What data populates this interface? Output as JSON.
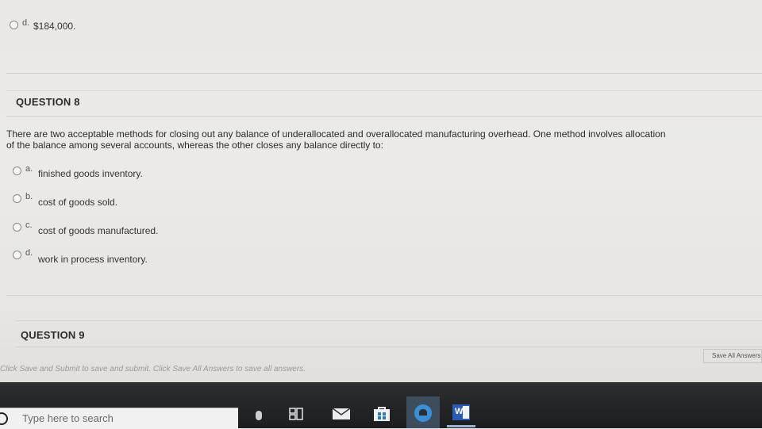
{
  "prev_question": {
    "option_d": {
      "letter": "d.",
      "text": "$184,000."
    }
  },
  "question8": {
    "header": "QUESTION 8",
    "prompt_line1": "There are two acceptable methods for closing out any balance of underallocated and overallocated manufacturing overhead. One method involves allocation",
    "prompt_line2": "of the balance among several accounts, whereas the other closes any balance directly to:",
    "options": [
      {
        "letter": "a.",
        "text": "finished goods inventory."
      },
      {
        "letter": "b.",
        "text": "cost of goods sold."
      },
      {
        "letter": "c.",
        "text": "cost of goods manufactured."
      },
      {
        "letter": "d.",
        "text": "work in process inventory."
      }
    ]
  },
  "question9": {
    "header": "QUESTION 9"
  },
  "footer": {
    "instructions": "Click Save and Submit to save and submit. Click Save All Answers to save all answers.",
    "save_all_label": "Save All Answers"
  },
  "taskbar": {
    "search_placeholder": "Type here to search",
    "icons": [
      "microphone-icon",
      "task-view-icon",
      "mail-icon",
      "store-icon",
      "edge-icon",
      "word-icon"
    ]
  }
}
